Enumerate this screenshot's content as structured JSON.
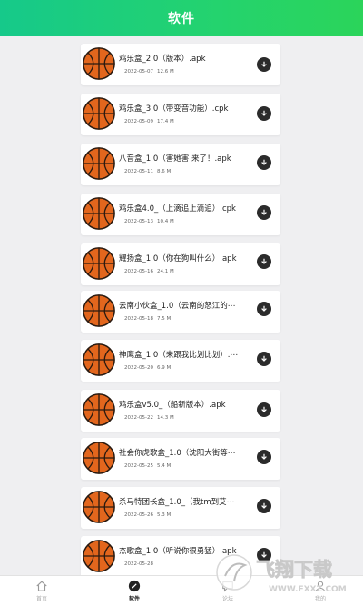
{
  "header": {
    "title": "软件"
  },
  "files": [
    {
      "name": "鸡乐盒_2.0（版本）.apk",
      "date": "2022-05-07",
      "size": "12.6 M"
    },
    {
      "name": "鸡乐盒_3.0（带变音功能）.cpk",
      "date": "2022-05-09",
      "size": "17.4 M"
    },
    {
      "name": "八音盒_1.0（害她害 来了！.apk",
      "date": "2022-05-11",
      "size": "8.6 M"
    },
    {
      "name": "鸡乐盒4.0_（上滴追上滴追）.cpk",
      "date": "2022-05-13",
      "size": "10.4 M"
    },
    {
      "name": "耀扬盒_1.0（你在狗叫什么）.apk",
      "date": "2022-05-16",
      "size": "24.1 M"
    },
    {
      "name": "云南小伙盒_1.0（云南的怒江的⋯",
      "date": "2022-05-18",
      "size": "7.5 M"
    },
    {
      "name": "神鹰盒_1.0（来跟我比划比划）.⋯",
      "date": "2022-05-20",
      "size": "6.9 M"
    },
    {
      "name": "鸡乐盒v5.0_（船新版本）.apk",
      "date": "2022-05-22",
      "size": "14.3 M"
    },
    {
      "name": "社会你虎歌盒_1.0（沈阳大街等⋯",
      "date": "2022-05-25",
      "size": "5.4 M"
    },
    {
      "name": "杀马特团长盒_1.0_（我tm到艾⋯",
      "date": "2022-05-26",
      "size": "5.3 M"
    },
    {
      "name": "杰歌盒_1.0（听说你很勇猛）.apk",
      "date": "2022-05-28",
      "size": ""
    }
  ],
  "tabs": [
    {
      "label": "首页",
      "icon": "home-icon"
    },
    {
      "label": "软件",
      "icon": "software-icon"
    },
    {
      "label": "论坛",
      "icon": "forum-icon"
    },
    {
      "label": "我的",
      "icon": "profile-icon"
    }
  ],
  "watermark": {
    "brand": "飞翔下载",
    "url": "WWW.FXXZ.COM"
  }
}
